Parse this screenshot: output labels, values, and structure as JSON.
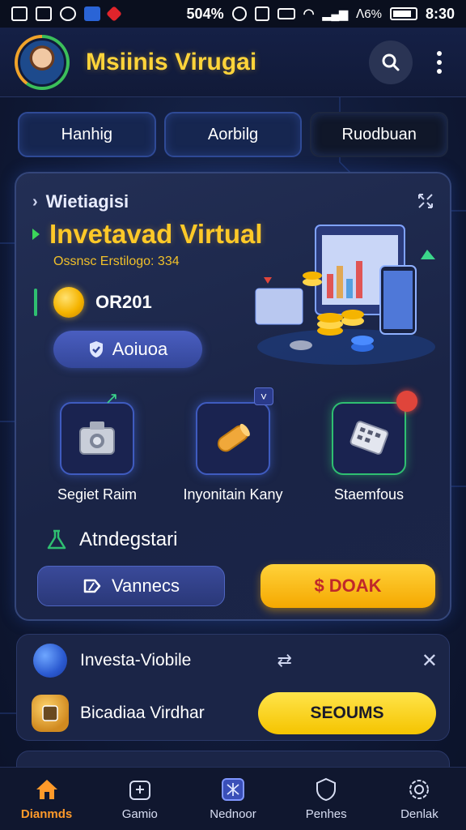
{
  "status_bar": {
    "battery_text": "504%",
    "signal_text": "ᐱ6%",
    "time": "8:30"
  },
  "header": {
    "title": "Msiinis Virugai",
    "search_icon": "search-icon",
    "menu_icon": "more-vertical-icon"
  },
  "tabs": [
    {
      "label": "Hanhig",
      "active": false
    },
    {
      "label": "Aorbilg",
      "active": false
    },
    {
      "label": "Ruodbuan",
      "active": true
    }
  ],
  "hero": {
    "subheading": "Wietiagisi",
    "title": "Invetavad Virtual",
    "subtitle": "Ossnsc Erstilogo: 334",
    "coin_value": "OR201",
    "action_label": "Aoiuoa"
  },
  "features": [
    {
      "label": "Segiet Raim",
      "icon": "camera-icon"
    },
    {
      "label": "Inyonitain Kany",
      "icon": "cylinder-icon"
    },
    {
      "label": "Staemfous",
      "icon": "device-icon"
    }
  ],
  "advantage": {
    "label": "Atndegstari"
  },
  "buttons": {
    "secondary_label": "Vannecs",
    "primary_label": "$ DOAK"
  },
  "promo": {
    "row1_text": "Investa-Viobile",
    "row2_text": "Bicadiaa Virdhar",
    "cta_label": "SEOUMS"
  },
  "bottom_nav": [
    {
      "label": "Dianmds",
      "icon": "home-icon",
      "active": true
    },
    {
      "label": "Gamio",
      "icon": "game-icon",
      "active": false
    },
    {
      "label": "Nednoor",
      "icon": "map-icon",
      "active": false
    },
    {
      "label": "Penhes",
      "icon": "shield-icon",
      "active": false
    },
    {
      "label": "Denlak",
      "icon": "settings-icon",
      "active": false
    }
  ],
  "colors": {
    "accent_gold": "#ffc928",
    "accent_orange": "#ff9a2a",
    "accent_green": "#2fbf71",
    "background": "#101a38"
  }
}
